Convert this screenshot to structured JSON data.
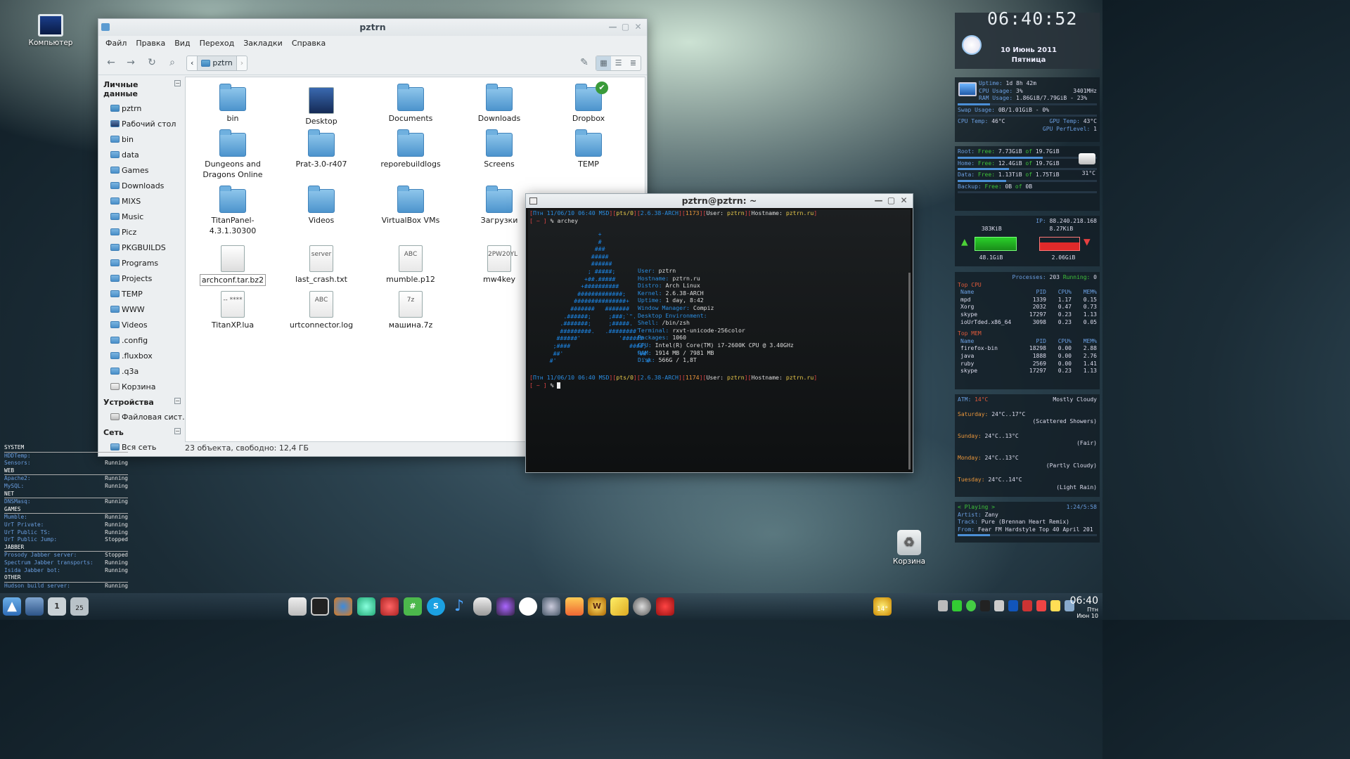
{
  "desktop": {
    "computer_label": "Компьютер",
    "trash_label": "Корзина"
  },
  "filemanager": {
    "title": "pztrn",
    "menu": [
      "Файл",
      "Правка",
      "Вид",
      "Переход",
      "Закладки",
      "Справка"
    ],
    "breadcrumb": "pztrn",
    "sidebar": {
      "personal_header": "Личные данные",
      "personal": [
        "pztrn",
        "Рабочий стол",
        "bin",
        "data",
        "Games",
        "Downloads",
        "MIXS",
        "Music",
        "Picz",
        "PKGBUILDS",
        "Programs",
        "Projects",
        "TEMP",
        "WWW",
        "Videos",
        ".config",
        ".fluxbox",
        ".q3a",
        "Корзина"
      ],
      "devices_header": "Устройства",
      "devices": [
        "Файловая сист..."
      ],
      "network_header": "Сеть",
      "network": [
        "Вся сеть"
      ]
    },
    "items": [
      {
        "name": "bin",
        "type": "folder"
      },
      {
        "name": "Desktop",
        "type": "desktop"
      },
      {
        "name": "Documents",
        "type": "folder"
      },
      {
        "name": "Downloads",
        "type": "folder"
      },
      {
        "name": "Dropbox",
        "type": "folder"
      },
      {
        "name": "Dungeons and Dragons Online",
        "type": "folder"
      },
      {
        "name": "Prat-3.0-r407",
        "type": "folder"
      },
      {
        "name": "reporebuildlogs",
        "type": "folder"
      },
      {
        "name": "Screens",
        "type": "folder"
      },
      {
        "name": "TEMP",
        "type": "folder"
      },
      {
        "name": "TitanPanel-4.3.1.30300",
        "type": "folder"
      },
      {
        "name": "Videos",
        "type": "folder"
      },
      {
        "name": "VirtualBox VMs",
        "type": "folder"
      },
      {
        "name": "Загрузки",
        "type": "folder"
      },
      {
        "name": "archconf.tar.bz2",
        "type": "archive"
      },
      {
        "name": "last_crash.txt",
        "type": "text",
        "glyph": "server"
      },
      {
        "name": "mumble.p12",
        "type": "text",
        "glyph": "ABC"
      },
      {
        "name": "mw4key",
        "type": "text",
        "glyph": "2PW20YL"
      },
      {
        "name": "TitanXP.lua",
        "type": "text",
        "glyph": "-- ****"
      },
      {
        "name": "urtconnector.log",
        "type": "text",
        "glyph": "ABC"
      },
      {
        "name": "машина.7z",
        "type": "archive7z",
        "glyph": "7z"
      }
    ],
    "status": "23 объекта, свободно: 12,4 ГБ"
  },
  "terminal": {
    "title": "pztrn@pztrn: ~",
    "prompt1": {
      "date": "Птн 11/06/10 06:40 MSD",
      "tty": "pts/0",
      "kernel": "2.6.38-ARCH",
      "num": "1173",
      "user": "pztrn",
      "host": "pztrn.ru"
    },
    "cmd1": "archey",
    "sysinfo": [
      [
        "User:",
        "pztrn"
      ],
      [
        "Hostname:",
        "pztrn.ru"
      ],
      [
        "Distro:",
        "Arch Linux"
      ],
      [
        "Kernel:",
        "2.6.38-ARCH"
      ],
      [
        "Uptime:",
        "1 day, 8:42"
      ],
      [
        "Window Manager:",
        "Compiz"
      ],
      [
        "Desktop Environment:",
        ""
      ],
      [
        "Shell:",
        "/bin/zsh"
      ],
      [
        "Terminal:",
        "rxvt-unicode-256color"
      ],
      [
        "Packages:",
        "1060"
      ],
      [
        "CPU:",
        "Intel(R) Core(TM) i7-2600K CPU @ 3.40GHz"
      ],
      [
        "RAM:",
        "1914 MB / 7981 MB"
      ],
      [
        "Disk:",
        "566G / 1,8T"
      ]
    ],
    "prompt2": {
      "date": "Птн 11/06/10 06:40 MSD",
      "tty": "pts/0",
      "kernel": "2.6.38-ARCH",
      "num": "1174",
      "user": "pztrn",
      "host": "pztrn.ru"
    }
  },
  "clock_widget": {
    "time": "06:40:52",
    "date": "10 Июнь 2011",
    "day": "Пятница"
  },
  "sys_widget": {
    "uptime": "1d 8h 42m",
    "cpu_usage": "3%",
    "cpu_freq": "3401MHz",
    "ram": "1.86GiB/7.79GiB - 23%",
    "ram_pct": 23,
    "swap": "0B/1.01GiB - 0%",
    "cpu_temp": "46°C",
    "gpu_temp": "43°C",
    "gpu_perflevel": "1"
  },
  "disk_widget": [
    {
      "label": "Root:",
      "free": "7.73GiB",
      "total": "19.7GiB",
      "pct": 61
    },
    {
      "label": "Home:",
      "free": "12.4GiB",
      "total": "19.7GiB",
      "pct": 37
    },
    {
      "label": "Data:",
      "free": "1.13TiB",
      "total": "1.75TiB",
      "pct": 35
    },
    {
      "label": "Backup:",
      "free": "0B",
      "total": "0B",
      "pct": 0
    }
  ],
  "disk_temp": "31°C",
  "net_widget": {
    "ip": "88.240.218.168",
    "down_rate": "383KiB",
    "up_rate": "8.27KiB",
    "down_total": "48.1GiB",
    "up_total": "2.06GiB"
  },
  "proc_widget": {
    "processes": "203",
    "running": "0",
    "top_cpu": [
      [
        "mpd",
        "1339",
        "1.17",
        "0.15"
      ],
      [
        "Xorg",
        "2032",
        "0.47",
        "0.73"
      ],
      [
        "skype",
        "17297",
        "0.23",
        "1.13"
      ],
      [
        "ioUrTded.x86_64",
        "3098",
        "0.23",
        "0.05"
      ]
    ],
    "top_mem": [
      [
        "firefox-bin",
        "18298",
        "0.00",
        "2.88"
      ],
      [
        "java",
        "1888",
        "0.00",
        "2.76"
      ],
      [
        "ruby",
        "2569",
        "0.00",
        "1.41"
      ],
      [
        "skype",
        "17297",
        "0.23",
        "1.13"
      ]
    ]
  },
  "weather_widget": {
    "atm": "14°C",
    "atm_cond": "Mostly Cloudy",
    "days": [
      {
        "day": "Saturday:",
        "temp": "24°C..17°C",
        "cond": "(Scattered Showers)"
      },
      {
        "day": "Sunday:",
        "temp": "24°C..13°C",
        "cond": "(Fair)"
      },
      {
        "day": "Monday:",
        "temp": "24°C..13°C",
        "cond": "(Partly Cloudy)"
      },
      {
        "day": "Tuesday:",
        "temp": "24°C..14°C",
        "cond": "(Light Rain)"
      }
    ]
  },
  "music_widget": {
    "status": "< Playing >",
    "time": "1:24/5:58",
    "artist": "Zany",
    "track": "Pure (Brennan Heart Remix)",
    "from": "Fear FM Hardstyle Top 40 April 201",
    "pct": 23
  },
  "services": [
    {
      "h": "SYSTEM"
    },
    {
      "n": "HDDTemp:",
      "s": ""
    },
    {
      "n": "Sensors:",
      "s": "Running"
    },
    {
      "h": "WEB"
    },
    {
      "n": "Apache2:",
      "s": "Running"
    },
    {
      "n": "MySQL:",
      "s": "Running"
    },
    {
      "h": "NET"
    },
    {
      "n": "DNSMasq:",
      "s": "Running"
    },
    {
      "h": "GAMES"
    },
    {
      "n": "Mumble:",
      "s": "Running"
    },
    {
      "n": "UrT Private:",
      "s": "Running"
    },
    {
      "n": "UrT Public TS:",
      "s": "Running"
    },
    {
      "n": "UrT Public Jump:",
      "s": "Stopped"
    },
    {
      "h": "JABBER"
    },
    {
      "n": "Prosody Jabber server:",
      "s": "Stopped"
    },
    {
      "n": "Spectrum Jabber transports:",
      "s": "Running"
    },
    {
      "n": "Isida Jabber bot:",
      "s": "Running"
    },
    {
      "h": "OTHER"
    },
    {
      "n": "Hudson build server:",
      "s": "Running"
    }
  ],
  "taskbar": {
    "clock": "06:40",
    "day": "Птн",
    "date": "Июн 10",
    "weather_temp": "14°",
    "desktop_num": "1",
    "badge": "25"
  }
}
